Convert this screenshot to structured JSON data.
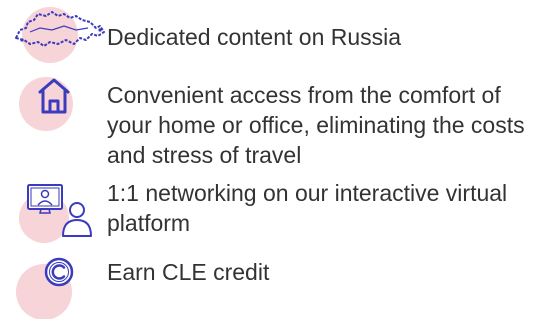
{
  "colors": {
    "accent_pink": "#f6d4d8",
    "icon_purple": "#3b3bbd",
    "text": "#333333"
  },
  "features": [
    {
      "icon": "russia-map-icon",
      "text": "Dedicated content on Russia"
    },
    {
      "icon": "home-icon",
      "text": "Convenient access from the comfort of your home or office, eliminating the costs and stress of travel"
    },
    {
      "icon": "virtual-networking-icon",
      "text": "1:1 networking on our interactive virtual platform"
    },
    {
      "icon": "copyright-icon",
      "text": "Earn CLE credit"
    }
  ]
}
